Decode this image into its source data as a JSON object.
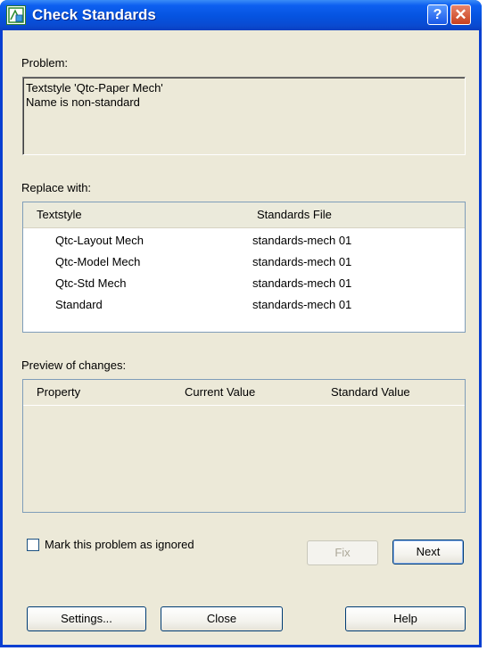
{
  "window": {
    "title": "Check Standards",
    "help_button": "?",
    "close_button": "✕"
  },
  "problem": {
    "label": "Problem:",
    "lines": [
      "Textstyle 'Qtc-Paper Mech'",
      "Name is non-standard"
    ]
  },
  "replace": {
    "label": "Replace with:",
    "columns": [
      "Textstyle",
      "Standards File"
    ],
    "rows": [
      [
        "Qtc-Layout Mech",
        "standards-mech 01"
      ],
      [
        "Qtc-Model Mech",
        "standards-mech 01"
      ],
      [
        "Qtc-Std Mech",
        "standards-mech 01"
      ],
      [
        "Standard",
        "standards-mech 01"
      ]
    ]
  },
  "preview": {
    "label": "Preview of changes:",
    "columns": [
      "Property",
      "Current Value",
      "Standard Value"
    ]
  },
  "ignore": {
    "label": "Mark this problem as ignored",
    "checked": false
  },
  "buttons": {
    "fix": "Fix",
    "next": "Next",
    "settings": "Settings...",
    "close": "Close",
    "help": "Help"
  }
}
